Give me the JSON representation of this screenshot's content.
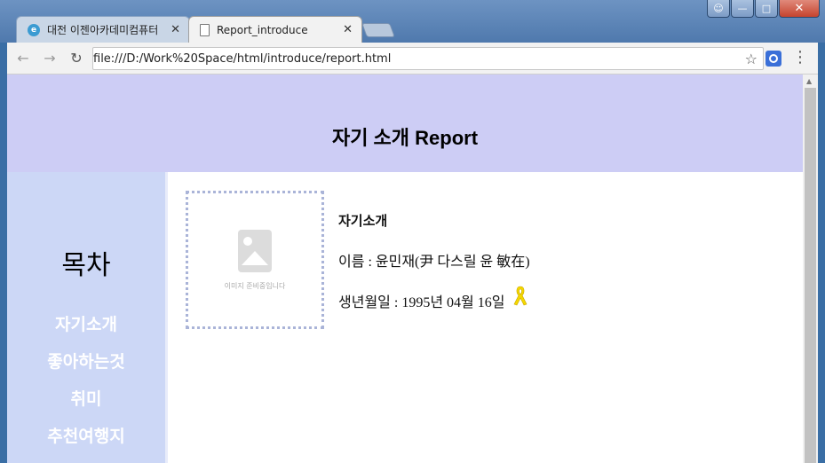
{
  "browser": {
    "tabs": [
      {
        "title": "대전 이젠아카데미컴퓨터",
        "favicon": "e-favicon-icon"
      },
      {
        "title": "Report_introduce",
        "favicon": "document-icon"
      }
    ],
    "address": "file:///D:/Work%20Space/html/introduce/report.html"
  },
  "page": {
    "header_title": "자기 소개 Report",
    "nav_title": "목차",
    "nav_items": [
      "자기소개",
      "좋아하는것",
      "취미",
      "추천여행지"
    ],
    "photo_caption": "이미지 준비중입니다",
    "section_heading": "자기소개",
    "name_line": "이름 : 윤민재(尹 다스릴 윤 敏在)",
    "birth_line": "생년월일 : 1995년 04월 16일"
  },
  "colors": {
    "header_bg": "#cdcdf5",
    "nav_bg": "#ccd7f6",
    "ribbon": "#f5d800"
  }
}
